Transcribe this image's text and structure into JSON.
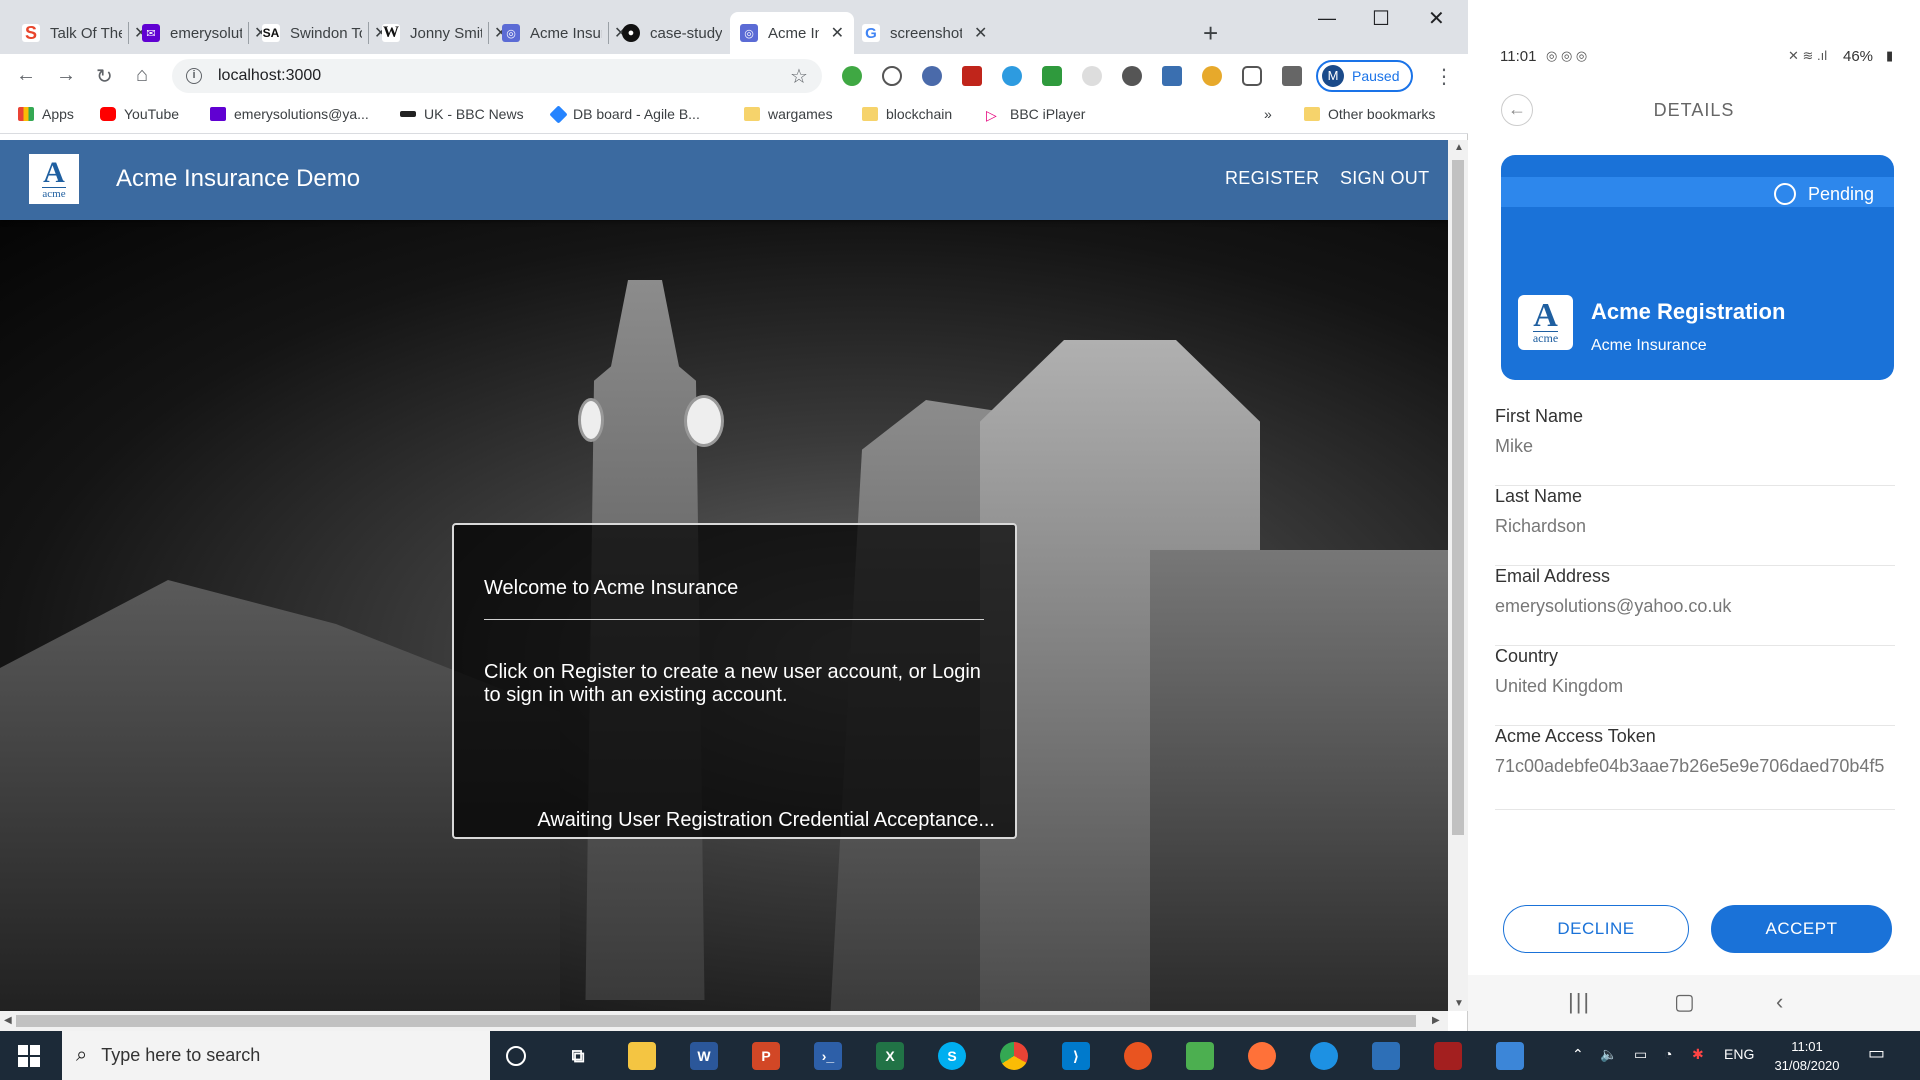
{
  "browser": {
    "tabs": [
      {
        "label": "Talk Of The Town",
        "icon": "swindon-s-icon",
        "color": "#e8452c",
        "glyph": "S"
      },
      {
        "label": "emerysolutions",
        "icon": "mail-icon",
        "color": "#6001d2",
        "glyph": "✉"
      },
      {
        "label": "Swindon Town",
        "icon": "sa-icon",
        "color": "#111111",
        "glyph": "SA"
      },
      {
        "label": "Jonny Smith",
        "icon": "wikipedia-icon",
        "color": "#ffffff",
        "glyph": "W"
      },
      {
        "label": "Acme Insurance",
        "icon": "acme-tab-icon",
        "color": "#5b6bd5",
        "glyph": "◎"
      },
      {
        "label": "case-study",
        "icon": "github-icon",
        "color": "#111111",
        "glyph": "●"
      },
      {
        "label": "Acme Insurance",
        "icon": "acme-tab-icon",
        "color": "#5b6bd5",
        "glyph": "◎",
        "active": true
      },
      {
        "label": "screenshot",
        "icon": "google-icon",
        "color": "#ffffff",
        "glyph": "G"
      }
    ],
    "url": "localhost:3000",
    "profile": {
      "initial": "M",
      "status": "Paused"
    },
    "bookmarks": [
      {
        "label": "Apps",
        "icon": "apps-grid-icon"
      },
      {
        "label": "YouTube",
        "icon": "youtube-icon"
      },
      {
        "label": "emerysolutions@ya...",
        "icon": "mail-icon"
      },
      {
        "label": "UK - BBC News",
        "icon": "bbc-icon"
      },
      {
        "label": "DB board - Agile B...",
        "icon": "jira-icon"
      },
      {
        "label": "wargames",
        "icon": "folder-icon"
      },
      {
        "label": "blockchain",
        "icon": "folder-icon"
      },
      {
        "label": "BBC iPlayer",
        "icon": "iplayer-icon"
      }
    ],
    "bookmarks_overflow": "»",
    "other_bookmarks": "Other bookmarks"
  },
  "app": {
    "logo_letter": "A",
    "logo_text": "acme",
    "title": "Acme Insurance Demo",
    "nav": {
      "register": "REGISTER",
      "sign_out": "SIGN OUT"
    },
    "card": {
      "heading": "Welcome to Acme Insurance",
      "body": "Click on Register to create a new user account, or Login to sign in with an existing account.",
      "status": "Awaiting User Registration Credential Acceptance..."
    }
  },
  "phone": {
    "time": "11:01",
    "battery": "46%",
    "header_title": "DETAILS",
    "credential": {
      "status": "Pending",
      "name": "Acme Registration",
      "issuer": "Acme Insurance"
    },
    "fields": [
      {
        "label": "First Name",
        "value": "Mike"
      },
      {
        "label": "Last Name",
        "value": "Richardson"
      },
      {
        "label": "Email Address",
        "value": "emerysolutions@yahoo.co.uk"
      },
      {
        "label": "Country",
        "value": "United Kingdom"
      },
      {
        "label": "Acme Access Token",
        "value": "71c00adebfe04b3aae7b26e5e9e706daed70b4f5"
      }
    ],
    "decline_label": "DECLINE",
    "accept_label": "ACCEPT"
  },
  "taskbar": {
    "search_placeholder": "Type here to search",
    "language": "ENG",
    "time": "11:01",
    "date": "31/08/2020",
    "colors": {
      "bar": "#1c2a38",
      "accent": "#1a72d8",
      "appbar": "#3b6aa0"
    }
  }
}
